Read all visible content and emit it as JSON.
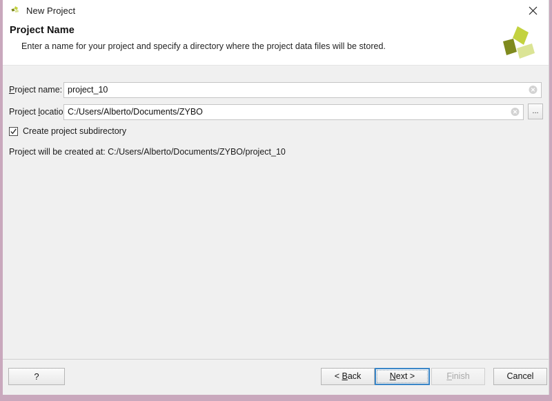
{
  "window": {
    "title": "New Project",
    "app_icon": "xilinx-logo-icon",
    "close_icon": "close-icon",
    "accent_border_color": "#c9a8bd",
    "focus_border_color": "#3a86c8"
  },
  "header": {
    "title": "Project Name",
    "description": "Enter a name for your project and specify a directory where the project data files will be stored.",
    "brand_icon": "xilinx-brand-logo-icon",
    "brand_colors": [
      "#7f8a1e",
      "#c3d23f",
      "#d9e38a"
    ]
  },
  "form": {
    "project_name": {
      "label_pre": "",
      "label_mnemonic": "P",
      "label_post": "roject name:",
      "value": "project_10",
      "placeholder": "",
      "clear_icon": "clear-circle-icon"
    },
    "project_location": {
      "label_pre": "Project ",
      "label_mnemonic": "l",
      "label_post": "ocation:",
      "value": "C:/Users/Alberto/Documents/ZYBO",
      "placeholder": "",
      "clear_icon": "clear-circle-icon",
      "browse_label": "...",
      "browse_icon": "browse-ellipsis-icon"
    },
    "create_subdirectory": {
      "label": "Create project subdirectory",
      "checked": true,
      "check_icon": "checkmark-icon"
    },
    "status_text": "Project will be created at: C:/Users/Alberto/Documents/ZYBO/project_10"
  },
  "footer": {
    "help_label": "?",
    "back_pre": "< ",
    "back_mnemonic": "B",
    "back_post": "ack",
    "next_pre": "",
    "next_mnemonic": "N",
    "next_post": "ext >",
    "finish_pre": "",
    "finish_mnemonic": "F",
    "finish_post": "inish",
    "finish_enabled": false,
    "cancel_label": "Cancel",
    "focused_button": "Next >"
  }
}
